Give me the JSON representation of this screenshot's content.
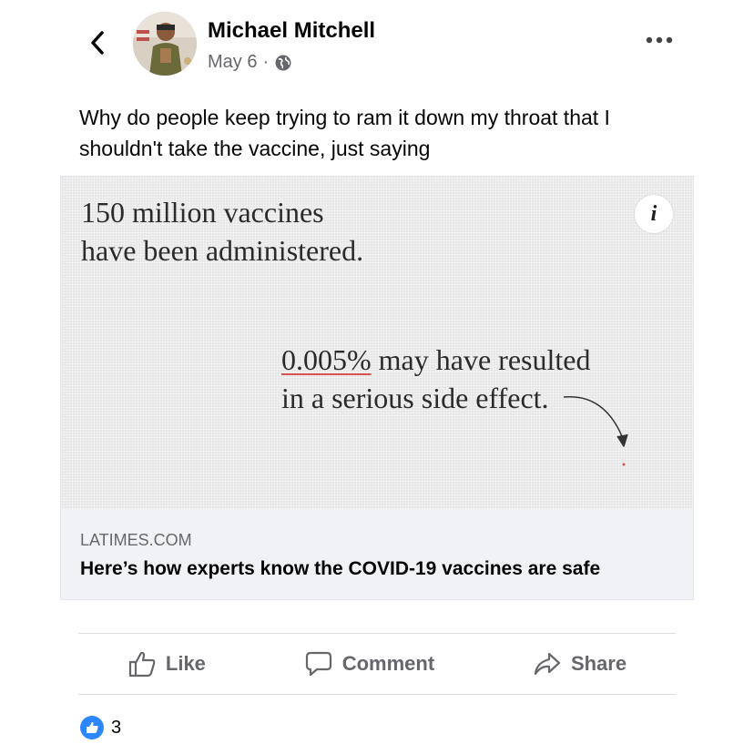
{
  "post": {
    "author": "Michael Mitchell",
    "date": "May 6",
    "separator": "·",
    "audience_icon": "globe-icon",
    "text": "Why do people keep trying to ram it down my throat that I shouldn't take the vaccine, just saying"
  },
  "link_preview": {
    "image_headline_line1": "150 million vaccines",
    "image_headline_line2": "have been administered.",
    "callout_percent": "0.005%",
    "callout_rest_line1": " may have resulted",
    "callout_line2": "in a serious side effect.",
    "info_label": "i",
    "domain": "LATIMES.COM",
    "title": "Here’s how experts know the COVID-19 vaccines are safe"
  },
  "actions": {
    "like": "Like",
    "comment": "Comment",
    "share": "Share"
  },
  "reactions": {
    "count": "3"
  },
  "colors": {
    "accent": "#2d88ff",
    "secondary_text": "#65676b",
    "highlight_underline": "#d9534f"
  }
}
